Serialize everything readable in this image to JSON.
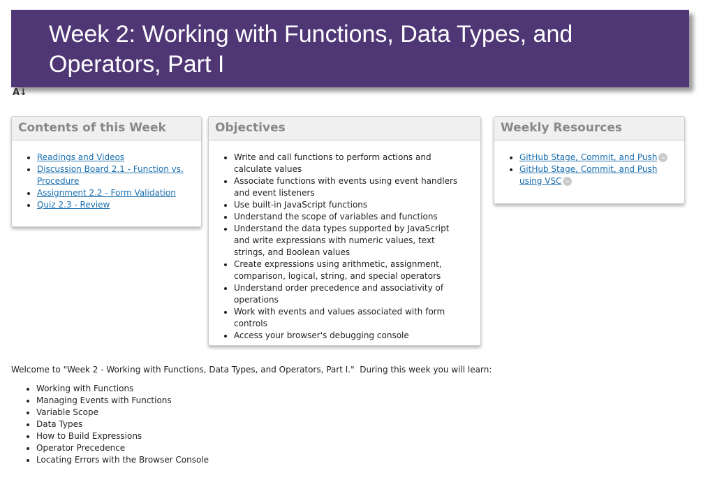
{
  "title": "Week 2: Working with Functions, Data Types, and Operators, Part I",
  "contents": {
    "heading": "Contents of this Week",
    "items": [
      "Readings and Videos",
      "Discussion Board 2.1 - Function vs. Procedure",
      "Assignment 2.2 - Form Validation",
      "Quiz 2.3 - Review"
    ]
  },
  "objectives": {
    "heading": "Objectives",
    "items": [
      "Write and call functions to perform actions and calculate values",
      "Associate functions with events using event handlers and event listeners",
      "Use built-in JavaScript functions",
      "Understand the scope of variables and functions",
      "Understand the data types supported by JavaScript and write expressions with numeric values, text strings, and Boolean values",
      "Create expressions using arithmetic, assignment, comparison, logical, string, and special operators",
      "Understand order precedence and associativity of operations",
      "Work with events and values associated with form controls",
      "Access your browser's debugging console"
    ]
  },
  "resources": {
    "heading": "Weekly Resources",
    "items": [
      "GitHub Stage, Commit, and Push",
      "GitHub Stage, Commit, and Push using VSC"
    ]
  },
  "intro": {
    "text": "Welcome to \"Week 2 - Working with Functions, Data Types, and Operators, Part I.\"  During this week you will learn:",
    "items": [
      "Working with Functions",
      "Managing Events with Functions",
      "Variable Scope",
      "Data Types",
      "How to Build Expressions",
      "Operator Precedence",
      "Locating Errors with the Browser Console"
    ]
  }
}
